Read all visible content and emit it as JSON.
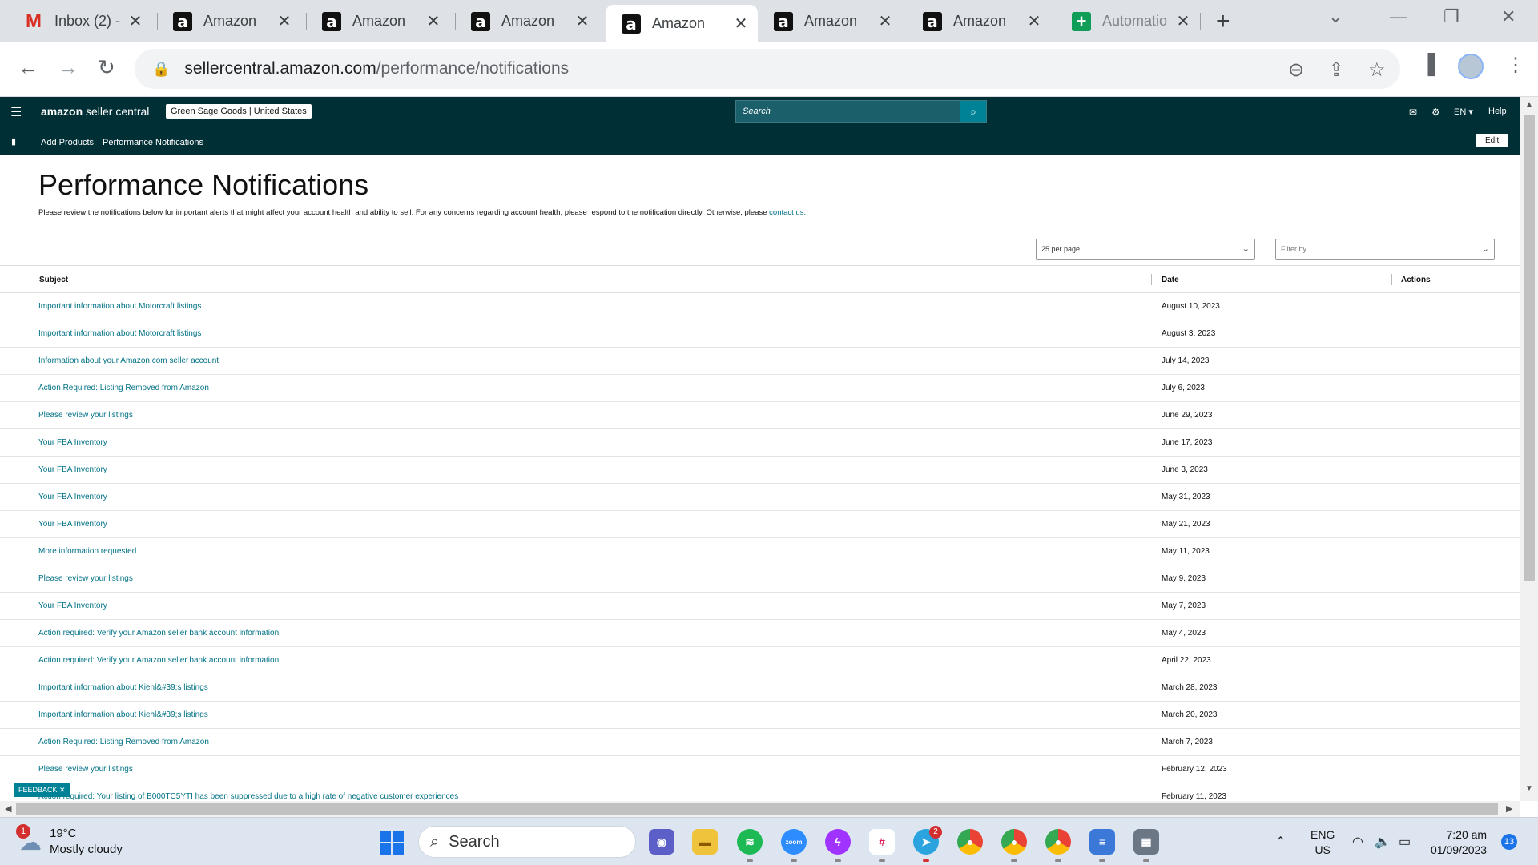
{
  "browser": {
    "tabs": [
      {
        "title": "Inbox (2) -",
        "favicon": "gmail-icon",
        "active": false
      },
      {
        "title": "Amazon",
        "favicon": "amazon-icon",
        "active": false
      },
      {
        "title": "Amazon",
        "favicon": "amazon-icon",
        "active": false
      },
      {
        "title": "Amazon",
        "favicon": "amazon-icon",
        "active": false
      },
      {
        "title": "Amazon",
        "favicon": "amazon-icon",
        "active": true
      },
      {
        "title": "Amazon",
        "favicon": "amazon-icon",
        "active": false
      },
      {
        "title": "Amazon",
        "favicon": "amazon-icon",
        "active": false
      },
      {
        "title": "Automatio",
        "favicon": "sheets-icon",
        "active": false
      }
    ],
    "url_host": "sellercentral.amazon.com",
    "url_path": "/performance/notifications"
  },
  "seller_central": {
    "logo_bold": "amazon",
    "logo_rest": " seller central",
    "store": "Green Sage Goods | United States",
    "search_placeholder": "Search",
    "language": "EN",
    "help": "Help",
    "subnav": {
      "links": [
        "Add Products",
        "Performance Notifications"
      ],
      "edit": "Edit"
    }
  },
  "page": {
    "title": "Performance Notifications",
    "intro_text": "Please review the notifications below for important alerts that might affect your account health and ability to sell. For any concerns regarding account health, please respond to the notification directly. Otherwise, please ",
    "intro_link": "contact us.",
    "per_page": "25 per page",
    "filter_placeholder": "Filter by",
    "columns": {
      "subject": "Subject",
      "date": "Date",
      "actions": "Actions"
    },
    "rows": [
      {
        "subject": "Important information about Motorcraft listings",
        "date": "August 10, 2023"
      },
      {
        "subject": "Important information about Motorcraft listings",
        "date": "August 3, 2023"
      },
      {
        "subject": "Information about your Amazon.com seller account",
        "date": "July 14, 2023"
      },
      {
        "subject": "Action Required: Listing Removed from Amazon",
        "date": "July 6, 2023"
      },
      {
        "subject": "Please review your listings",
        "date": "June 29, 2023"
      },
      {
        "subject": "Your FBA Inventory",
        "date": "June 17, 2023"
      },
      {
        "subject": "Your FBA Inventory",
        "date": "June 3, 2023"
      },
      {
        "subject": "Your FBA Inventory",
        "date": "May 31, 2023"
      },
      {
        "subject": "Your FBA Inventory",
        "date": "May 21, 2023"
      },
      {
        "subject": "More information requested",
        "date": "May 11, 2023"
      },
      {
        "subject": "Please review your listings",
        "date": "May 9, 2023"
      },
      {
        "subject": "Your FBA Inventory",
        "date": "May 7, 2023"
      },
      {
        "subject": "Action required: Verify your Amazon seller bank account information",
        "date": "May 4, 2023"
      },
      {
        "subject": "Action required: Verify your Amazon seller bank account information",
        "date": "April 22, 2023"
      },
      {
        "subject": "Important information about Kiehl&#39;s listings",
        "date": "March 28, 2023"
      },
      {
        "subject": "Important information about Kiehl&#39;s listings",
        "date": "March 20, 2023"
      },
      {
        "subject": "Action Required: Listing Removed from Amazon",
        "date": "March 7, 2023"
      },
      {
        "subject": "Please review your listings",
        "date": "February 12, 2023"
      },
      {
        "subject": "Action required: Your listing of B000TC5YTI has been suppressed due to a high rate of negative customer experiences",
        "date": "February 11, 2023"
      }
    ],
    "feedback": "FEEDBACK"
  },
  "taskbar": {
    "weather_temp": "19°C",
    "weather_desc": "Mostly cloudy",
    "weather_badge": "1",
    "search": "Search",
    "telegram_badge": "2",
    "lang_1": "ENG",
    "lang_2": "US",
    "time": "7:20 am",
    "date": "01/09/2023",
    "notifications": "13"
  }
}
